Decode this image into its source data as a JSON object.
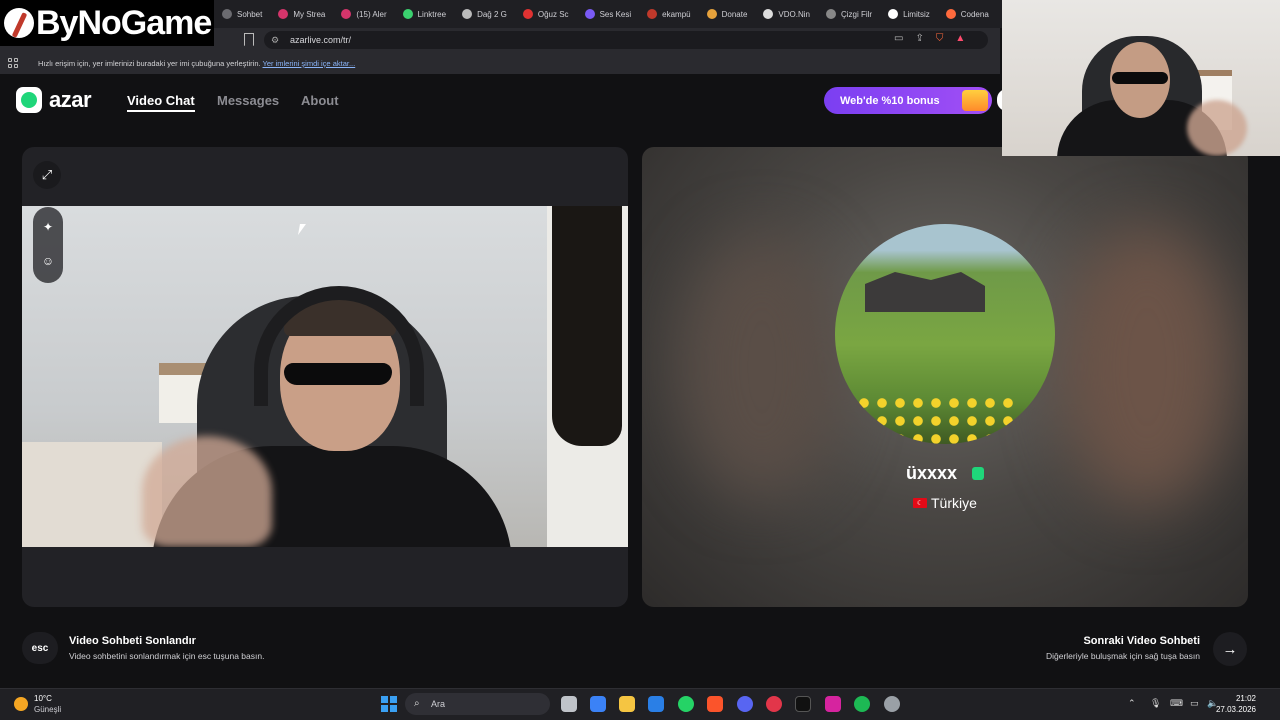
{
  "browser": {
    "tabs": [
      "Sohbet",
      "My Strea",
      "(15) Aler",
      "Linktree",
      "Dağ 2 G",
      "Oğuz Sc",
      "Ses Kesi",
      "ekampü",
      "Donate",
      "VDO.Nin",
      "Çizgi Filr",
      "Limitsiz",
      "Codena"
    ],
    "tab_colors": [
      "#6b6b70",
      "#d4356b",
      "#d4356b",
      "#3bd16f",
      "#bbbbbb",
      "#e03232",
      "#7a5af5",
      "#c0392b",
      "#e6a23c",
      "#dddddd",
      "#888888",
      "#ffffff",
      "#ff6a3d"
    ],
    "url": "azarlive.com/tr/",
    "bookmarks_text": "Hızlı erişim için, yer imlerinizi buradaki yer imi çubuğuna yerleştirin.",
    "bookmarks_link": "Yer imlerini şimdi içe aktar..."
  },
  "watermark": {
    "text": "ByNoGame"
  },
  "site": {
    "logo_text": "azar",
    "nav": [
      "Video Chat",
      "Messages",
      "About"
    ],
    "promo": "Web'de %10 bonus"
  },
  "partner": {
    "name": "üxxxx",
    "country": "Türkiye"
  },
  "hints": {
    "esc_key": "esc",
    "end_title": "Video Sohbeti Sonlandır",
    "end_sub": "Video sohbetini sonlandırmak için esc tuşuna basın.",
    "next_title": "Sonraki Video Sohbeti",
    "next_sub": "Diğerleriyle buluşmak için sağ tuşa basın"
  },
  "taskbar": {
    "weather_temp": "10°C",
    "weather_desc": "Güneşli",
    "search_placeholder": "Ara",
    "time": "21:02",
    "date": "27.03.2026"
  },
  "colors": {
    "accent_green": "#1fd67a",
    "promo_purple": "#8a45f3",
    "panel_bg": "#222226"
  }
}
